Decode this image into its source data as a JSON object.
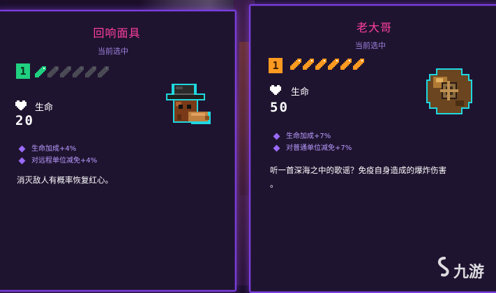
{
  "cards": [
    {
      "name": "回响面具",
      "status": "当前选中",
      "tier": "1",
      "tier_color": "#20d080",
      "pips_filled": 1,
      "pips_total": 6,
      "stat_label": "生命",
      "stat_value": "20",
      "bonuses": [
        "生命加成+4%",
        "对远程单位减免+4%"
      ],
      "description": "消灭敌人有概率恢复红心。",
      "portrait_icon": "bowler-hat-plague-mask-icon"
    },
    {
      "name": "老大哥",
      "status": "当前选中",
      "tier": "1",
      "tier_color": "#ff9a20",
      "pips_filled": 6,
      "pips_total": 6,
      "stat_label": "生命",
      "stat_value": "50",
      "bonuses": [
        "生命加成+7%",
        "对普通单位减免+7%"
      ],
      "description_line1": "听一首深海之中的歌谣？免疫自身造成的爆炸伤害",
      "description_line2": "。",
      "portrait_icon": "diving-helmet-icon"
    }
  ],
  "watermark": "九游"
}
